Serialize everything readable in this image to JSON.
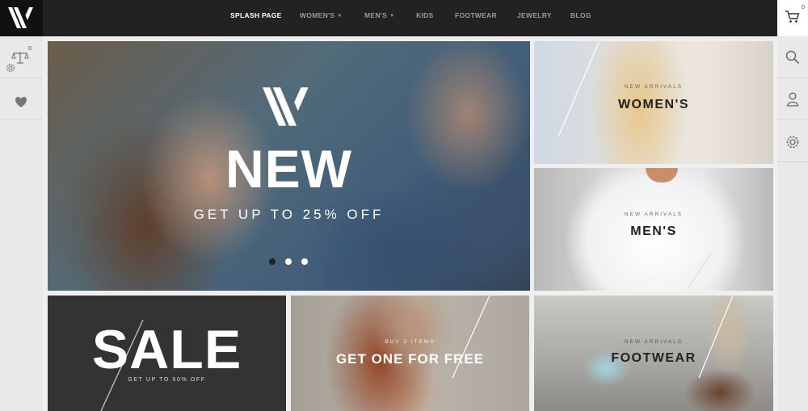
{
  "nav": {
    "items": [
      {
        "label": "SPLASH PAGE",
        "active": true,
        "dropdown": false
      },
      {
        "label": "WOMEN'S",
        "active": false,
        "dropdown": true
      },
      {
        "label": "MEN'S",
        "active": false,
        "dropdown": true
      },
      {
        "label": "KIDS",
        "active": false,
        "dropdown": false
      },
      {
        "label": "FOOTWEAR",
        "active": false,
        "dropdown": false
      },
      {
        "label": "JEWELRY",
        "active": false,
        "dropdown": false
      },
      {
        "label": "BLOG",
        "active": false,
        "dropdown": false
      }
    ]
  },
  "right_panel": {
    "cart_count": "0",
    "icons": [
      "cart-icon",
      "search-icon",
      "user-icon",
      "settings-icon"
    ]
  },
  "left_panel": {
    "compare_count": "0",
    "icons": [
      "compare-icon",
      "settings-icon",
      "heart-icon"
    ]
  },
  "hero": {
    "title": "NEW",
    "subtitle": "GET UP TO 25% OFF",
    "slides": 3,
    "active_slide": 1
  },
  "tiles": {
    "womens": {
      "small": "NEW ARRIVALS",
      "big": "WOMEN'S"
    },
    "mens": {
      "small": "NEW ARRIVALS",
      "big": "MEN'S"
    },
    "sale": {
      "big": "SALE",
      "small": "GET UP TO 50% OFF"
    },
    "promo": {
      "small": "BUY 2 ITEMS",
      "big": "GET ONE FOR FREE"
    },
    "footwear": {
      "small": "NEW ARRIVALS",
      "big": "FOOTWEAR"
    }
  },
  "colors": {
    "topbar": "#222222",
    "nav_active": "#ffffff",
    "nav_inactive": "#9a9a9a",
    "sale_tile": "#333333"
  }
}
